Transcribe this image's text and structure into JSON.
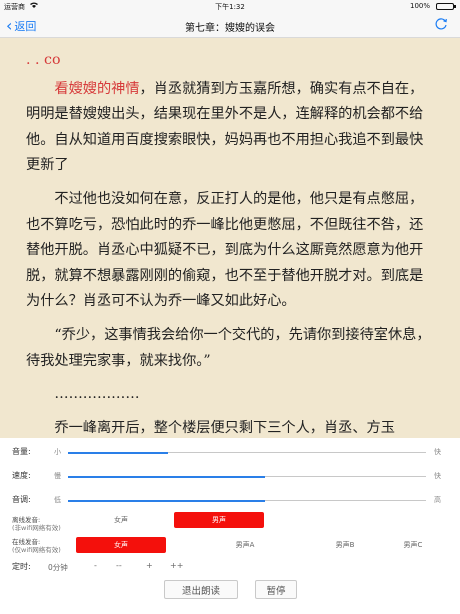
{
  "status_bar": {
    "carrier": "运营商",
    "time": "下午1:32",
    "battery_percent": "100%",
    "battery_level": 1.0
  },
  "nav": {
    "back_label": "返回",
    "title": "第七章：嫂嫂的误会"
  },
  "content": {
    "lines": [
      ". . co",
      "看嫂嫂的神情",
      "，肖丞就猜到方玉嘉所想，确实有点不自在，明明是替嫂嫂出头，结果现在里外不是人，连解释的机会都不给他。自从知道用百度搜索眼快，妈妈再也不用担心我追不到最快更新了",
      "不过他也没如何在意，反正打人的是他，他只是有点憋屈，也不算吃亏，恐怕此时的乔一峰比他更憋屈，不但既往不咎，还替他开脱。肖丞心中狐疑不已，到底为什么这厮竟然愿意为他开脱，就算不想暴露刚刚的偷窥，也不至于替他开脱才对。到底是为什么？肖丞可不认为乔一峰又如此好心。",
      "“乔少，这事情我会给你一个交代的，先请你到接待室休息，待我处理完家事，就来找你。”",
      "………………",
      "乔一峰离开后，整个楼层便只剩下三个人，肖丞、方玉"
    ]
  },
  "controls": {
    "volume": {
      "label": "音量:",
      "min": "小",
      "max": "快",
      "level": 0.28
    },
    "speed": {
      "label": "速度:",
      "min": "慢",
      "max": "快",
      "level": 0.55
    },
    "pitch": {
      "label": "音调:",
      "min": "低",
      "max": "高",
      "level": 0.55
    },
    "offline": {
      "label": "离线发音:",
      "sub": "(非wifi网络有效)",
      "options": [
        "女声",
        "男声"
      ],
      "selected": "男声"
    },
    "online": {
      "label": "在线发音:",
      "sub": "(仅wifi网络有效)",
      "options": [
        "女声",
        "男声A",
        "男声B",
        "男声C"
      ],
      "selected": "女声"
    },
    "timer": {
      "label": "定时:",
      "value": "0分钟",
      "buttons": [
        "-",
        "--",
        "+",
        "++"
      ]
    },
    "exit_label": "退出朗读",
    "pause_label": "暂停"
  },
  "colors": {
    "accent": "#1a7cf4",
    "slider_fill": "#2a7fe8",
    "selected_voice": "#f4100c",
    "highlight_text": "#d63a3a",
    "page_background": "#f1e7cf"
  }
}
